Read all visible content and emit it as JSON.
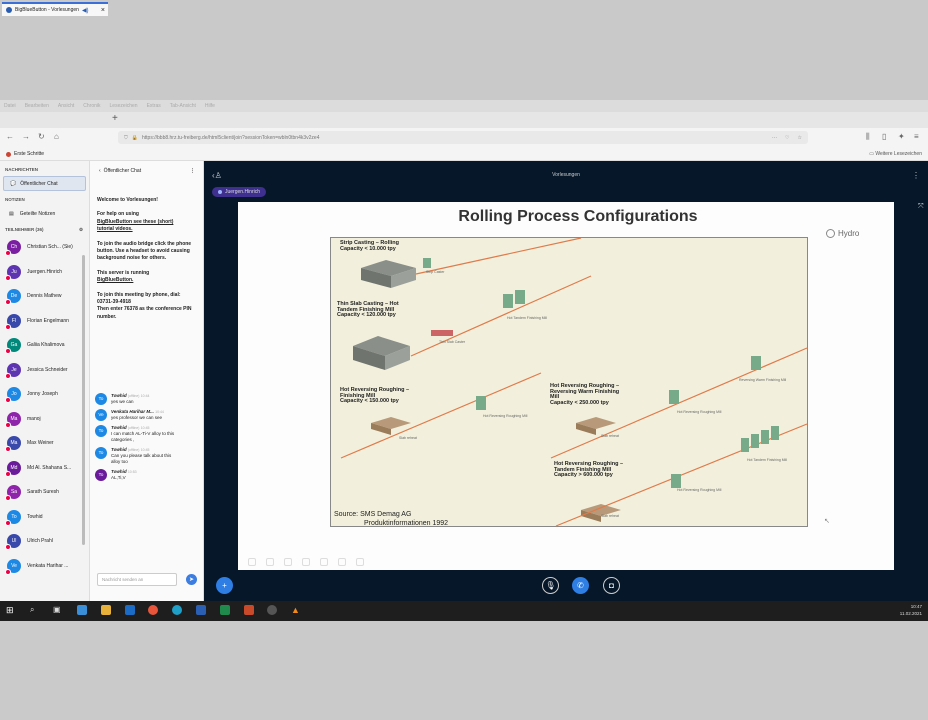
{
  "browser": {
    "menu": [
      "Datei",
      "Bearbeiten",
      "Ansicht",
      "Chronik",
      "Lesezeichen",
      "Extras",
      "Tab-Ansicht",
      "Hilfe"
    ],
    "tab_title": "BigBlueButton - Vorlesungen",
    "url": "https://bbb8.hrz.tu-freiberg.de/html5client/join?sessionToken=wbln0tbn4k3v2ze4",
    "bookmark_left": "Erste Schritte",
    "bookmark_right": "Weitere Lesezeichen"
  },
  "sidebar": {
    "messages_label": "NACHRICHTEN",
    "public_chat": "Öffentlicher Chat",
    "notes_label": "NOTIZEN",
    "shared_notes": "Geteilte Notizen",
    "participants_label": "TEILNEHMER (36)",
    "users": [
      {
        "initials": "Ch",
        "name": "Christian Sch... (Sie)",
        "color": "#7b1fa2"
      },
      {
        "initials": "Ju",
        "name": "Juergen.Hinrich",
        "color": "#5e35b1"
      },
      {
        "initials": "De",
        "name": "Dennis Mathew",
        "color": "#1e88e5"
      },
      {
        "initials": "Fl",
        "name": "Florian Engelmann",
        "color": "#3949ab"
      },
      {
        "initials": "Ga",
        "name": "Galiia Khalimova",
        "color": "#00897b"
      },
      {
        "initials": "Je",
        "name": "Jessica Schneider",
        "color": "#5e35b1"
      },
      {
        "initials": "Jo",
        "name": "Jonny Joseph",
        "color": "#1e88e5"
      },
      {
        "initials": "Ma",
        "name": "manoj",
        "color": "#8e24aa"
      },
      {
        "initials": "Ma",
        "name": "Max Weiner",
        "color": "#3949ab"
      },
      {
        "initials": "Md",
        "name": "Md Al. Shahana S...",
        "color": "#6a1b9a"
      },
      {
        "initials": "Sa",
        "name": "Sarath Suresh",
        "color": "#8e24aa"
      },
      {
        "initials": "To",
        "name": "Towhid",
        "color": "#1e88e5"
      },
      {
        "initials": "Ul",
        "name": "Ulrich Prahl",
        "color": "#3949ab"
      },
      {
        "initials": "Ve",
        "name": "Venkata Harihar ...",
        "color": "#1e88e5"
      }
    ]
  },
  "chat": {
    "title": "Öffentlicher Chat",
    "welcome": {
      "heading": "Welcome to Vorlesungen!",
      "p1a": "For help on using",
      "p1b": "BigBlueButton see these (short)",
      "p1c": "tutorial videos.",
      "p2": "To join the audio bridge click the phone button. Use a headset to avoid causing background noise for others.",
      "p3a": "This server is running",
      "p3b": "BigBlueButton.",
      "p4a": "To join this meeting by phone, dial:",
      "p4b": "03731-39-4918",
      "p4c": "Then enter 76378 as the conference PIN number."
    },
    "messages": [
      {
        "initials": "To",
        "color": "#1e88e5",
        "name": "Towhid",
        "tag": "(offline)",
        "time": "10:44",
        "lines": [
          "yes we can"
        ]
      },
      {
        "initials": "Ve",
        "color": "#1e88e5",
        "name": "Venkata Harihar M...",
        "tag": "",
        "time": "10:44",
        "lines": [
          "yes professor we can see"
        ]
      },
      {
        "initials": "To",
        "color": "#1e88e5",
        "name": "Towhid",
        "tag": "(offline)",
        "time": "10:45",
        "lines": [
          "I can match AL-Ti-V alloy to this",
          "categories ,"
        ]
      },
      {
        "initials": "To",
        "color": "#1e88e5",
        "name": "Towhid",
        "tag": "(offline)",
        "time": "10:45",
        "lines": [
          "Can you please talk about this",
          "alloy too"
        ]
      },
      {
        "initials": "To",
        "color": "#6a1b9a",
        "name": "Towhid",
        "tag": "",
        "time": "10:53",
        "lines": [
          "AL,Ti,V"
        ]
      }
    ],
    "input_placeholder": "Nachricht senden an"
  },
  "main": {
    "title": "Vorlesungen",
    "presenter": "Juergen.Hinrich"
  },
  "slide": {
    "title": "Rolling Process Configurations",
    "logo": "Hydro",
    "labels": {
      "strip": "Strip Casting – Rolling\nCapacity < 10.000 tpy",
      "thin": "Thin Slab Casting – Hot\nTandem Finishing Mill\nCapacity < 120.000 tpy",
      "hrr": "Hot Reversing Roughing –\nFinishing Mill\nCapacity < 150.000 tpy",
      "hrrw": "Hot Reversing Roughing –\nReversing Warm Finishing\nMill\nCapacity < 250.000 tpy",
      "hrrt": "Hot Reversing Roughing –\nTandem Finishing Mill\nCapacity > 600.000 tpy"
    },
    "small": {
      "strip_caster": "Strip Caster",
      "hot_tandem": "Hot Tandem Finishing Mill",
      "thin_caster": "Thin Slab Caster",
      "slab_reheat": "Slab reheat",
      "hrm": "Hot Reversing Roughing Mill",
      "rwfm": "Reversing Warm Finishing Mill"
    },
    "source_line1": "Source: SMS Demag AG",
    "source_line2": "Produktinformationen 1992"
  },
  "taskbar": {
    "time": "10:47",
    "date": "11.02.2021"
  }
}
